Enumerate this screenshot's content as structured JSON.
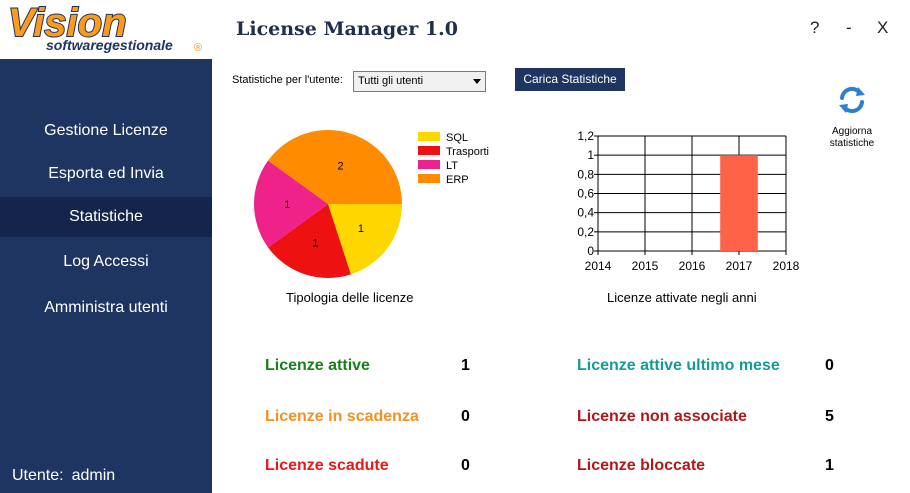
{
  "window": {
    "title": "License Manager 1.0",
    "help_label": "?",
    "minimize_label": "-",
    "close_label": "X"
  },
  "logo": {
    "brand": "Vision",
    "sub": "softwaregestionale",
    "mark": "®"
  },
  "sidebar": {
    "items": [
      {
        "label": "Gestione Licenze"
      },
      {
        "label": "Esporta ed Invia"
      },
      {
        "label": "Statistiche",
        "active": true
      },
      {
        "label": "Log Accessi"
      },
      {
        "label": "Amministra utenti"
      }
    ],
    "user_label": "Utente:",
    "user_name": "admin"
  },
  "toolbar": {
    "filter_label": "Statistiche per l'utente:",
    "filter_value": "Tutti gli utenti",
    "load_button": "Carica Statistiche",
    "refresh_label": "Aggiorna statistiche",
    "refresh_icon": "refresh-icon"
  },
  "chart_data": [
    {
      "type": "pie",
      "title": "Tipologia delle licenze",
      "categories": [
        "SQL",
        "Trasporti",
        "LT",
        "ERP"
      ],
      "values": [
        1,
        1,
        1,
        2
      ],
      "colors": [
        "#ffd700",
        "#ee1111",
        "#ee2288",
        "#ff8c00"
      ],
      "legend": "right"
    },
    {
      "type": "bar",
      "title": "Licenze attivate negli anni",
      "categories": [
        "2014",
        "2015",
        "2016",
        "2017",
        "2018"
      ],
      "values": [
        0,
        0,
        0,
        1,
        0
      ],
      "ylim": [
        0,
        1.2
      ],
      "y_ticks": [
        "0",
        "0,2",
        "0,4",
        "0,6",
        "0,8",
        "1",
        "1,2"
      ],
      "grid": true,
      "colors": [
        "#ff6347"
      ]
    }
  ],
  "stats": {
    "attive": {
      "label": "Licenze attive",
      "value": "1",
      "color": "#1a7f1a"
    },
    "scadenza": {
      "label": "Licenze in scadenza",
      "value": "0",
      "color": "#f39224"
    },
    "scadute": {
      "label": "Licenze scadute",
      "value": "0",
      "color": "#e81818"
    },
    "attive_mese": {
      "label": "Licenze attive ultimo mese",
      "value": "0",
      "color": "#159a9a"
    },
    "non_associate": {
      "label": "Licenze non associate",
      "value": "5",
      "color": "#b01818"
    },
    "bloccate": {
      "label": "Licenze bloccate",
      "value": "1",
      "color": "#b01818"
    }
  }
}
